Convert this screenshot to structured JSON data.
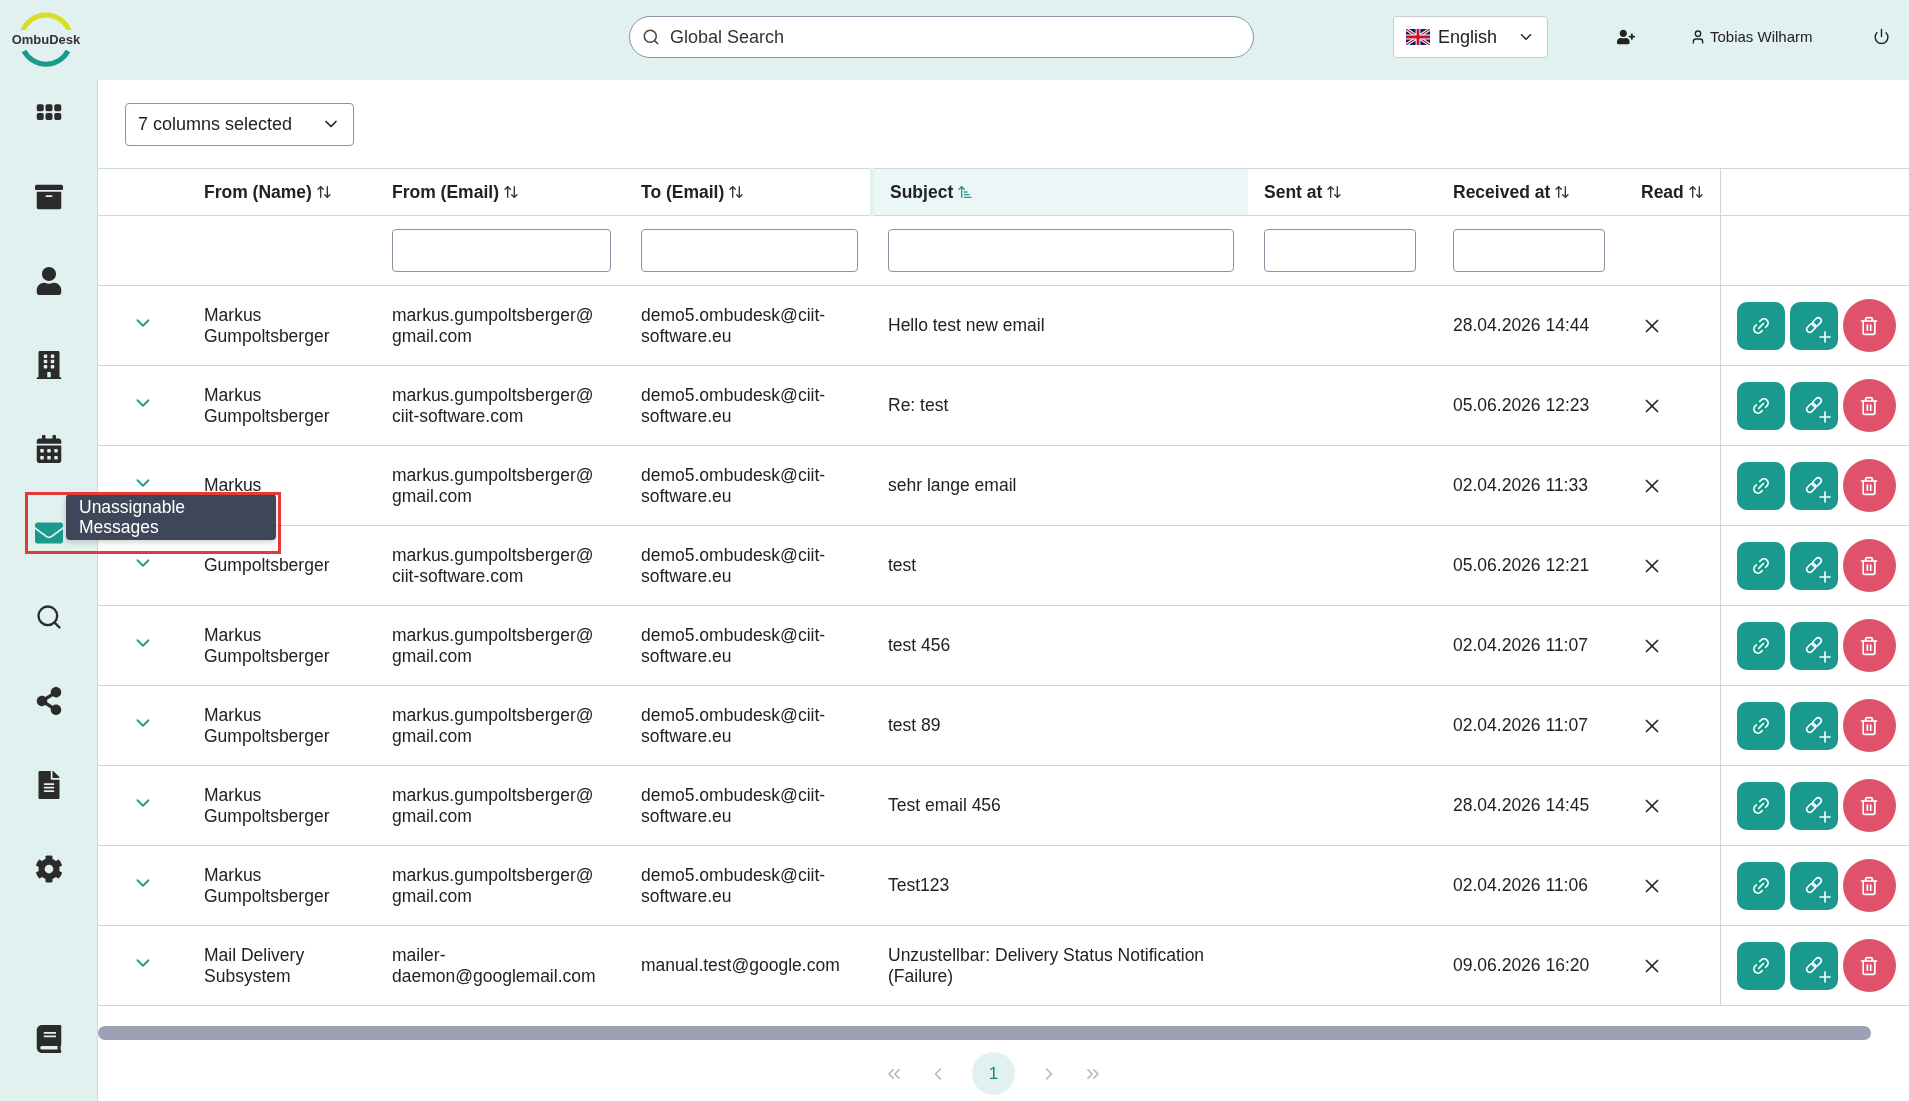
{
  "header": {
    "logo": "OmbuDesk",
    "search": {
      "placeholder": "Global Search"
    },
    "language": "English",
    "user": "Tobias Wilharm"
  },
  "sidebar": {
    "items": [
      {
        "selected": false
      },
      {
        "selected": false
      },
      {
        "selected": false
      },
      {
        "selected": false
      },
      {
        "selected": false
      },
      {
        "selected": true
      },
      {
        "selected": false
      },
      {
        "selected": false
      },
      {
        "selected": false
      },
      {
        "selected": false
      },
      {
        "selected": false
      }
    ],
    "tooltip": "Unassignable Messages"
  },
  "column_picker": "7 columns selected",
  "table": {
    "columns": [
      {
        "label": "From (Name)",
        "sorted": false,
        "filter": false,
        "highlighted": false
      },
      {
        "label": "From (Email)",
        "sorted": false,
        "filter": true,
        "highlighted": false
      },
      {
        "label": "To (Email)",
        "sorted": false,
        "filter": true,
        "highlighted": false
      },
      {
        "label": "Subject",
        "sorted": true,
        "filter": true,
        "highlighted": true
      },
      {
        "label": "Sent at",
        "sorted": false,
        "filter": true,
        "highlighted": false
      },
      {
        "label": "Received at",
        "sorted": false,
        "filter": true,
        "highlighted": false
      },
      {
        "label": "Read",
        "sorted": false,
        "filter": false,
        "highlighted": false
      }
    ],
    "rows": [
      {
        "from_name": "Markus Gumpoltsberger",
        "from_email": "markus.gumpoltsberger@ gmail.com",
        "to_email": "demo5.ombudesk@ciit- software.eu",
        "subject": "Hello test new email",
        "received_at": "28.04.2026 14:44",
        "read": false
      },
      {
        "from_name": "Markus Gumpoltsberger",
        "from_email": "markus.gumpoltsberger@ ciit-software.com",
        "to_email": "demo5.ombudesk@ciit- software.eu",
        "subject": "Re: test",
        "received_at": "05.06.2026 12:23",
        "read": false
      },
      {
        "from_name": "Markus",
        "from_email": "markus.gumpoltsberger@ gmail.com",
        "to_email": "demo5.ombudesk@ciit- software.eu",
        "subject": "sehr lange email",
        "received_at": "02.04.2026 11:33",
        "read": false
      },
      {
        "from_name": "Gumpoltsberger",
        "from_email": "markus.gumpoltsberger@ ciit-software.com",
        "to_email": "demo5.ombudesk@ciit- software.eu",
        "subject": "test",
        "received_at": "05.06.2026 12:21",
        "read": false
      },
      {
        "from_name": "Markus Gumpoltsberger",
        "from_email": "markus.gumpoltsberger@ gmail.com",
        "to_email": "demo5.ombudesk@ciit- software.eu",
        "subject": "test 456",
        "received_at": "02.04.2026 11:07",
        "read": false
      },
      {
        "from_name": "Markus Gumpoltsberger",
        "from_email": "markus.gumpoltsberger@ gmail.com",
        "to_email": "demo5.ombudesk@ciit- software.eu",
        "subject": "test 89",
        "received_at": "02.04.2026 11:07",
        "read": false
      },
      {
        "from_name": "Markus Gumpoltsberger",
        "from_email": "markus.gumpoltsberger@ gmail.com",
        "to_email": "demo5.ombudesk@ciit- software.eu",
        "subject": "Test email 456",
        "received_at": "28.04.2026 14:45",
        "read": false
      },
      {
        "from_name": "Markus Gumpoltsberger",
        "from_email": "markus.gumpoltsberger@ gmail.com",
        "to_email": "demo5.ombudesk@ciit- software.eu",
        "subject": "Test123",
        "received_at": "02.04.2026 11:06",
        "read": false
      },
      {
        "from_name": "Mail Delivery Subsystem",
        "from_email": "mailer- daemon@googlemail.com",
        "to_email": "manual.test@google.com",
        "subject": "Unzustellbar: Delivery Status Notification (Failure)",
        "received_at": "09.06.2026 16:20",
        "read": false
      }
    ]
  },
  "pagination": {
    "pages": [
      {
        "label": "1",
        "selected": true
      }
    ]
  }
}
